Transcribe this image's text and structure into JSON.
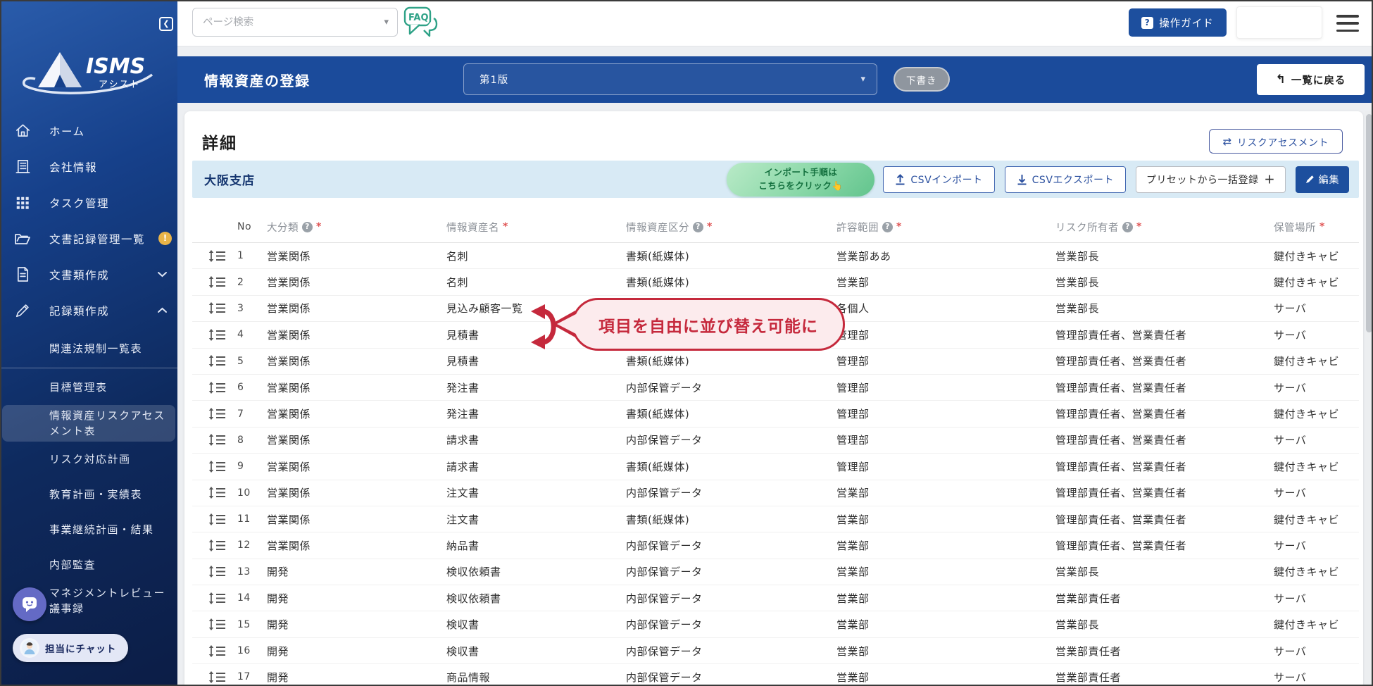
{
  "colors": {
    "sidebar_navy": "#0c1d46",
    "header_blue": "#1b4b9b",
    "accent_blue": "#1d4f9e",
    "bar_light_blue": "#d8eaf5",
    "tooltip_green": "#6dc896",
    "annotation_red": "#c5293c",
    "badge_yellow": "#e9b448",
    "chat_purple": "#646ac5",
    "draft_gray": "#8f969f",
    "csv_blue": "#2b509f"
  },
  "logo": {
    "title": "ISMS",
    "subtitle": "アシスト"
  },
  "topbar": {
    "search_placeholder": "ページ検索",
    "search_caret": "▾",
    "faq_label": "FAQ",
    "guide_button": "操作ガイド",
    "guide_icon": "?"
  },
  "page_header": {
    "title": "情報資産の登録",
    "version_selected": "第1版",
    "version_caret": "▾",
    "status_badge": "下書き",
    "back_button": "一覧に戻る",
    "back_arrow": "↰"
  },
  "sidebar": {
    "items": [
      {
        "label": "ホーム",
        "icon": "home-icon"
      },
      {
        "label": "会社情報",
        "icon": "building-icon"
      },
      {
        "label": "タスク管理",
        "icon": "grid-icon"
      },
      {
        "label": "文書記録管理一覧",
        "icon": "folder-icon",
        "badge": "!"
      },
      {
        "label": "文書類作成",
        "icon": "document-icon",
        "chevron": "down"
      },
      {
        "label": "記録類作成",
        "icon": "pencil-icon",
        "chevron": "up"
      }
    ],
    "sub_items": [
      {
        "label": "関連法規制一覧表",
        "active": false,
        "divider_after": true
      },
      {
        "label": "目標管理表",
        "active": false
      },
      {
        "label": "情報資産リスクアセスメント表",
        "active": true
      },
      {
        "label": "リスク対応計画",
        "active": false
      },
      {
        "label": "教育計画・実績表",
        "active": false
      },
      {
        "label": "事業継続計画・結果",
        "active": false
      },
      {
        "label": "内部監査",
        "active": false
      },
      {
        "label": "マネジメントレビュー議事録",
        "active": false
      }
    ],
    "chat_button": "担当にチャット"
  },
  "main": {
    "section_title": "詳細",
    "risk_assessment_button": "リスクアセスメント",
    "swap_glyph": "⇄",
    "branch_name": "大阪支店",
    "import_tooltip_line1": "インポート手順は",
    "import_tooltip_line2": "こちらをクリック👆",
    "csv_import_button": "CSVインポート",
    "csv_export_button": "CSVエクスポート",
    "preset_button": "プリセットから一括登録",
    "preset_plus": "＋",
    "edit_button": "編集"
  },
  "annotation": {
    "text": "項目を自由に並び替え可能に"
  },
  "table": {
    "columns": [
      {
        "key": "no",
        "label": "No",
        "help": false,
        "required": false
      },
      {
        "key": "cat",
        "label": "大分類",
        "help": true,
        "required": true
      },
      {
        "key": "name",
        "label": "情報資産名",
        "help": false,
        "required": true
      },
      {
        "key": "type",
        "label": "情報資産区分",
        "help": true,
        "required": true
      },
      {
        "key": "scope",
        "label": "許容範囲",
        "help": true,
        "required": true
      },
      {
        "key": "owner",
        "label": "リスク所有者",
        "help": true,
        "required": true
      },
      {
        "key": "loc",
        "label": "保管場所",
        "help": false,
        "required": true
      }
    ],
    "help_glyph": "?",
    "required_glyph": "*",
    "rows": [
      {
        "no": "1",
        "cat": "営業関係",
        "name": "名刺",
        "type": "書類(紙媒体)",
        "scope": "営業部ああ",
        "owner": "営業部長",
        "loc": "鍵付きキャビ"
      },
      {
        "no": "2",
        "cat": "営業関係",
        "name": "名刺",
        "type": "書類(紙媒体)",
        "scope": "営業部",
        "owner": "営業部長",
        "loc": "鍵付きキャビ"
      },
      {
        "no": "3",
        "cat": "営業関係",
        "name": "見込み顧客一覧",
        "type": "",
        "scope": "各個人",
        "owner": "営業部長",
        "loc": "サーバ"
      },
      {
        "no": "4",
        "cat": "営業関係",
        "name": "見積書",
        "type": "",
        "scope": "管理部",
        "owner": "管理部責任者、営業責任者",
        "loc": "サーバ"
      },
      {
        "no": "5",
        "cat": "営業関係",
        "name": "見積書",
        "type": "書類(紙媒体)",
        "scope": "管理部",
        "owner": "管理部責任者、営業責任者",
        "loc": "鍵付きキャビ"
      },
      {
        "no": "6",
        "cat": "営業関係",
        "name": "発注書",
        "type": "内部保管データ",
        "scope": "管理部",
        "owner": "管理部責任者、営業責任者",
        "loc": "サーバ"
      },
      {
        "no": "7",
        "cat": "営業関係",
        "name": "発注書",
        "type": "書類(紙媒体)",
        "scope": "管理部",
        "owner": "管理部責任者、営業責任者",
        "loc": "鍵付きキャビ"
      },
      {
        "no": "8",
        "cat": "営業関係",
        "name": "請求書",
        "type": "内部保管データ",
        "scope": "管理部",
        "owner": "管理部責任者、営業責任者",
        "loc": "サーバ"
      },
      {
        "no": "9",
        "cat": "営業関係",
        "name": "請求書",
        "type": "書類(紙媒体)",
        "scope": "管理部",
        "owner": "管理部責任者、営業責任者",
        "loc": "鍵付きキャビ"
      },
      {
        "no": "10",
        "cat": "営業関係",
        "name": "注文書",
        "type": "内部保管データ",
        "scope": "営業部",
        "owner": "管理部責任者、営業責任者",
        "loc": "サーバ"
      },
      {
        "no": "11",
        "cat": "営業関係",
        "name": "注文書",
        "type": "書類(紙媒体)",
        "scope": "営業部",
        "owner": "管理部責任者、営業責任者",
        "loc": "鍵付きキャビ"
      },
      {
        "no": "12",
        "cat": "営業関係",
        "name": "納品書",
        "type": "内部保管データ",
        "scope": "営業部",
        "owner": "管理部責任者、営業責任者",
        "loc": "サーバ"
      },
      {
        "no": "13",
        "cat": "開発",
        "name": "検収依頼書",
        "type": "内部保管データ",
        "scope": "営業部",
        "owner": "営業部長",
        "loc": "鍵付きキャビ"
      },
      {
        "no": "14",
        "cat": "開発",
        "name": "検収依頼書",
        "type": "内部保管データ",
        "scope": "営業部",
        "owner": "営業部責任者",
        "loc": "サーバ"
      },
      {
        "no": "15",
        "cat": "開発",
        "name": "検収書",
        "type": "内部保管データ",
        "scope": "営業部",
        "owner": "営業部長",
        "loc": "鍵付きキャビ"
      },
      {
        "no": "16",
        "cat": "開発",
        "name": "検収書",
        "type": "内部保管データ",
        "scope": "営業部",
        "owner": "営業部責任者",
        "loc": "サーバ"
      },
      {
        "no": "17",
        "cat": "開発",
        "name": "商品情報",
        "type": "内部保管データ",
        "scope": "営業部",
        "owner": "営業部責任者",
        "loc": "サーバ"
      }
    ]
  }
}
